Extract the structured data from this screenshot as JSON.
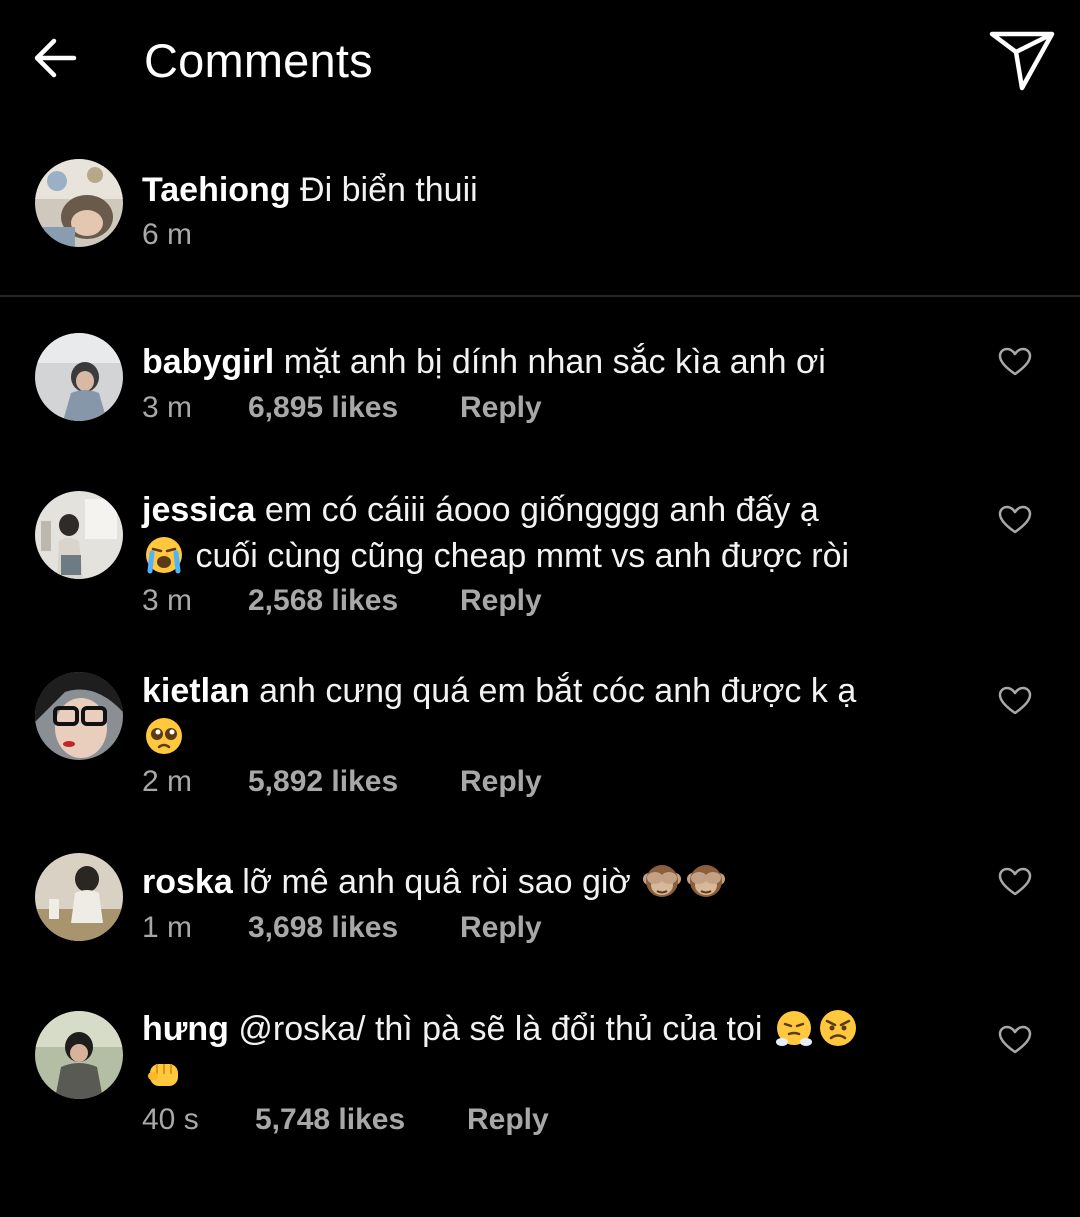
{
  "header": {
    "title": "Comments",
    "back_icon": "arrow-left-icon",
    "send_icon": "paper-plane-icon"
  },
  "caption": {
    "username": "Taehiong",
    "text": "Đi biển thuii",
    "time": "6 m"
  },
  "comments": [
    {
      "username": "babygirl",
      "text": "mặt anh bị dính nhan sắc kìa anh ơi",
      "time": "3 m",
      "likes": "6,895 likes",
      "reply": "Reply"
    },
    {
      "username": "jessica",
      "text": "em có cáiii áooo giốngggg anh đấy ạ",
      "emoji": [
        "loudly-crying-face"
      ],
      "text2": "cuối cùng cũng cheap mmt vs anh được ròi",
      "time": "3 m",
      "likes": "2,568 likes",
      "reply": "Reply"
    },
    {
      "username": "kietlan",
      "text": "anh cưng quá em bắt cóc anh được k ạ",
      "emoji": [
        "pleading-face"
      ],
      "time": "2 m",
      "likes": "5,892 likes",
      "reply": "Reply"
    },
    {
      "username": "roska",
      "text": "lỡ mê anh quâ ròi sao giờ",
      "emoji": [
        "see-no-evil-monkey",
        "see-no-evil-monkey"
      ],
      "time": "1 m",
      "likes": "3,698 likes",
      "reply": "Reply"
    },
    {
      "username": "hưng",
      "text": "@roska/ thì pà sẽ là đổi thủ của toi",
      "emoji": [
        "face-with-steam-from-nose",
        "angry-face",
        "oncoming-fist"
      ],
      "time": "40 s",
      "likes": "5,748 likes",
      "reply": "Reply"
    }
  ],
  "colors": {
    "background": "#000000",
    "text_primary": "#ffffff",
    "text_secondary": "#a8a8a8",
    "divider": "#262626"
  }
}
